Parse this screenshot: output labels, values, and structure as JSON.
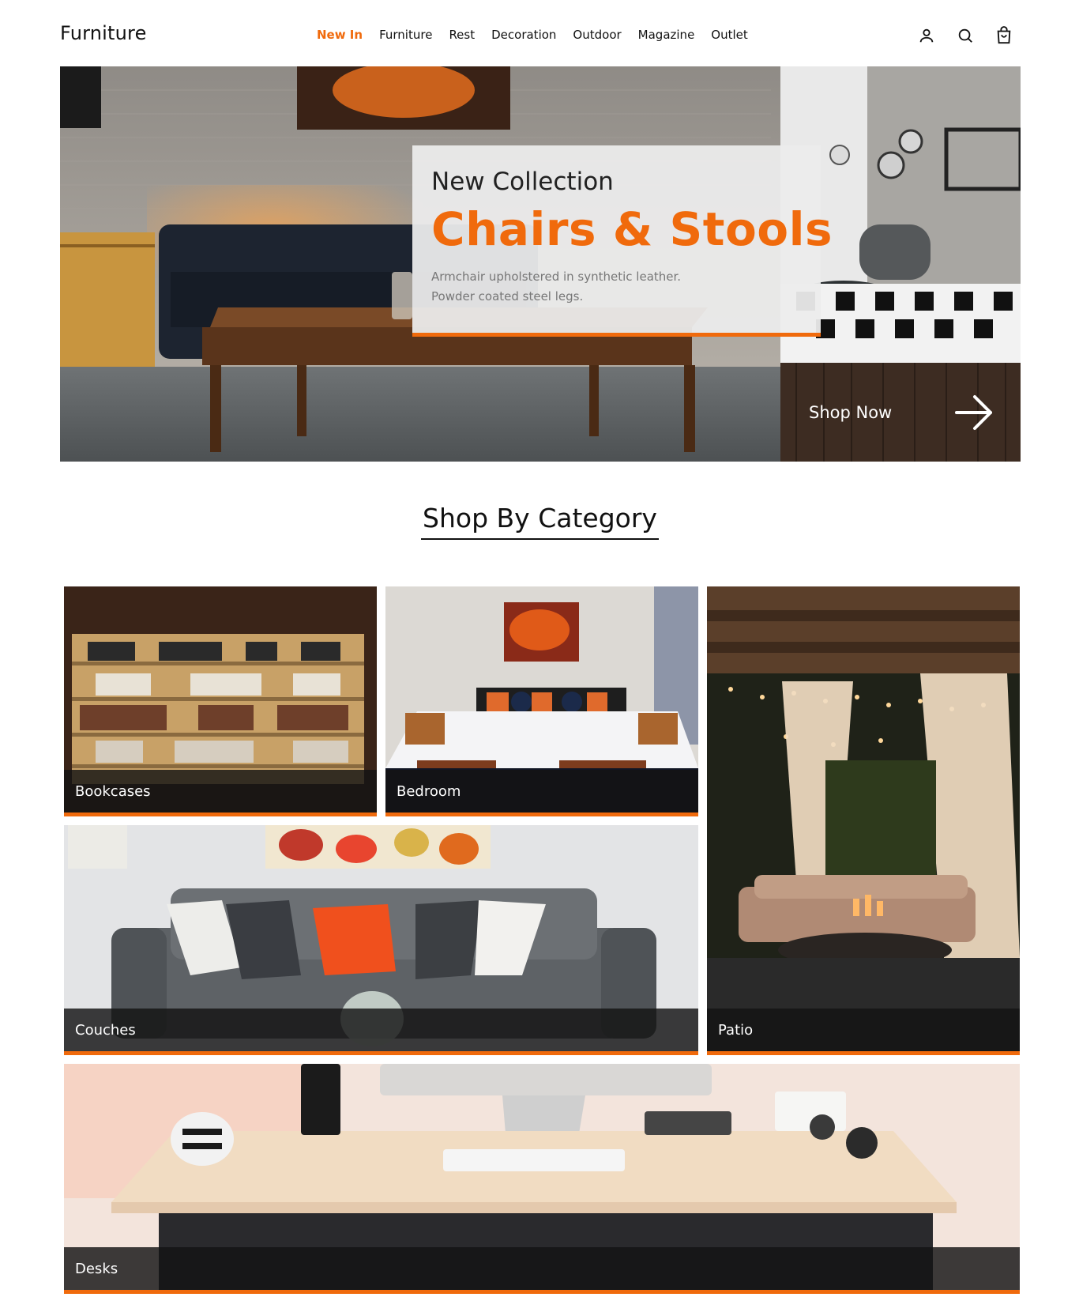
{
  "header": {
    "logo": "Furniture",
    "nav": [
      {
        "label": "New In",
        "active": true
      },
      {
        "label": "Furniture",
        "active": false
      },
      {
        "label": "Rest",
        "active": false
      },
      {
        "label": "Decoration",
        "active": false
      },
      {
        "label": "Outdoor",
        "active": false
      },
      {
        "label": "Magazine",
        "active": false
      },
      {
        "label": "Outlet",
        "active": false
      }
    ],
    "icons": [
      "user-icon",
      "search-icon",
      "cart-icon"
    ]
  },
  "hero": {
    "subtitle": "New Collection",
    "title": "Chairs & Stools",
    "description": "Armchair upholstered in synthetic leather. Powder coated steel legs.",
    "cta": "Shop Now"
  },
  "categories": {
    "heading": "Shop By Category",
    "items": [
      "Bookcases",
      "Bedroom",
      "Patio",
      "Couches",
      "Desks"
    ]
  },
  "theme": {
    "accent": "#f06a0c",
    "text": "#111111"
  }
}
